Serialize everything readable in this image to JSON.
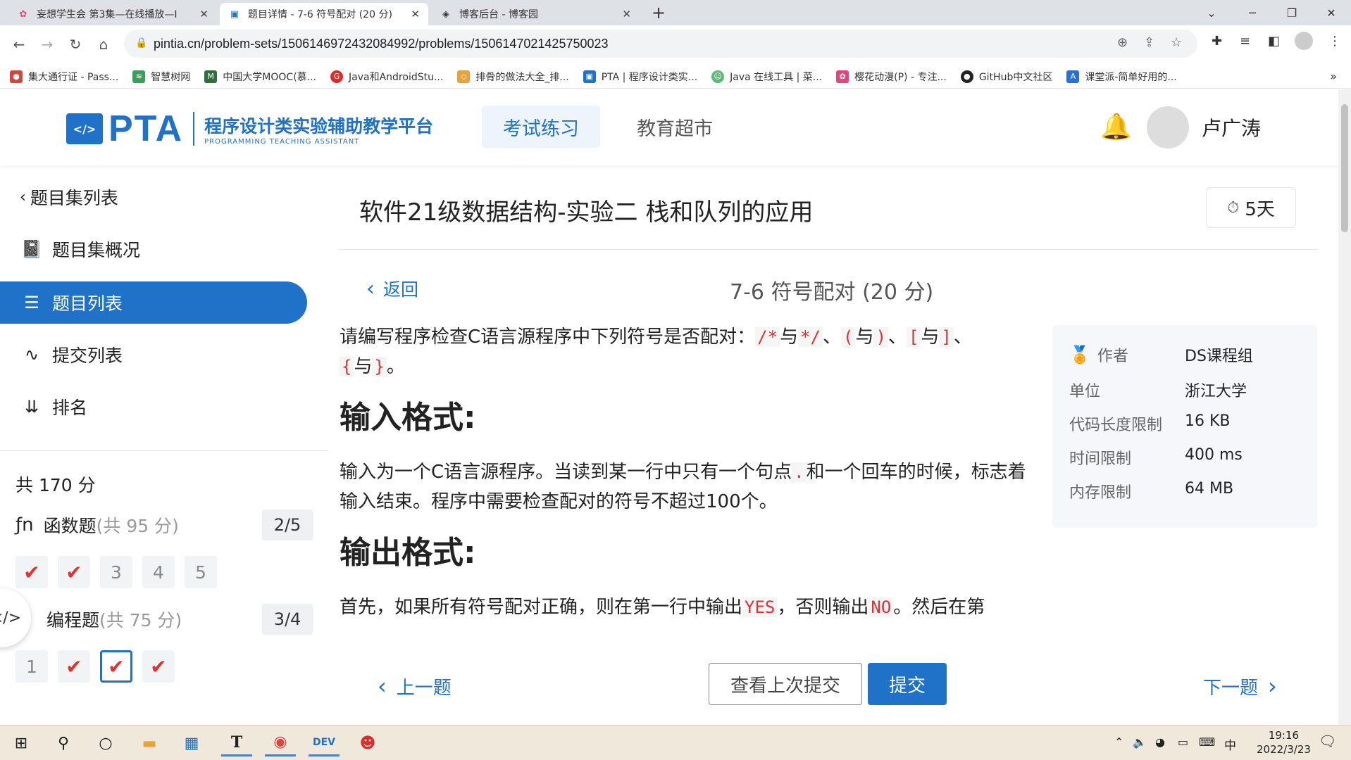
{
  "browser": {
    "tabs": [
      {
        "title": "妄想学生会 第3集—在线播放—I",
        "icon": "flower-icon",
        "active": false
      },
      {
        "title": "题目详情 - 7-6 符号配对 (20 分)",
        "icon": "pta-icon",
        "active": true
      },
      {
        "title": "博客后台 - 博客园",
        "icon": "cnblogs-icon",
        "active": false
      }
    ],
    "new_tab": "+",
    "url": "pintia.cn/problem-sets/1506146972432084992/problems/1506147021425750023",
    "bookmarks": [
      "集大通行证 - Pass...",
      "智慧树网",
      "中国大学MOOC(慕...",
      "Java和AndroidStu...",
      "排骨的做法大全_排...",
      "PTA | 程序设计类实...",
      "Java 在线工具 | 菜...",
      "樱花动漫(P) - 专注...",
      "GitHub中文社区",
      "课堂派-简单好用的..."
    ],
    "bookmarks_more": "»"
  },
  "header": {
    "logo_abbr": "PTA",
    "logo_cn": "程序设计类实验辅助教学平台",
    "logo_en": "PROGRAMMING TEACHING ASSISTANT",
    "nav": [
      "考试练习",
      "教育超市"
    ],
    "username": "卢广涛"
  },
  "sidebar": {
    "back_link": "题目集列表",
    "items": [
      {
        "label": "题目集概况",
        "icon": "book-icon"
      },
      {
        "label": "题目列表",
        "icon": "list-icon",
        "active": true
      },
      {
        "label": "提交列表",
        "icon": "activity-icon"
      },
      {
        "label": "排名",
        "icon": "rank-icon"
      }
    ],
    "total": "共 170 分",
    "groups": [
      {
        "label": "函数题",
        "sub": "(共 95 分)",
        "count": "2/5",
        "questions": [
          "✔",
          "✔",
          "3",
          "4",
          "5"
        ]
      },
      {
        "label": "编程题",
        "sub": "(共 75 分)",
        "count": "3/4",
        "questions": [
          "1",
          "✔",
          "✔",
          "✔"
        ]
      }
    ]
  },
  "main": {
    "set_title": "软件21级数据结构-实验二 栈和队列的应用",
    "timer": "5天",
    "back": "返回",
    "problem_title": "7-6 符号配对 (20 分)",
    "desc_prefix": "请编写程序检查C语言源程序中下列符号是否配对：",
    "symbols": [
      "/*",
      "与",
      "*/",
      "、",
      "(",
      "与",
      ")",
      "、",
      "[",
      "与",
      "]",
      "、",
      "{",
      "与",
      "}",
      "。"
    ],
    "input_heading": "输入格式:",
    "input_text_1": "输入为一个C语言源程序。当读到某一行中只有一个句点",
    "input_code": ".",
    "input_text_2": "和一个回车的时候，标志着输入结束。程序中需要检查配对的符号不超过100个。",
    "output_heading": "输出格式:",
    "output_text_1": "首先，如果所有符号配对正确，则在第一行中输出",
    "output_code_1": "YES",
    "output_text_2": "，否则输出",
    "output_code_2": "NO",
    "output_text_3": "。然后在第"
  },
  "info": [
    {
      "label": "作者",
      "value": "DS课程组"
    },
    {
      "label": "单位",
      "value": "浙江大学"
    },
    {
      "label": "代码长度限制",
      "value": "16 KB"
    },
    {
      "label": "时间限制",
      "value": "400 ms"
    },
    {
      "label": "内存限制",
      "value": "64 MB"
    }
  ],
  "footer": {
    "prev": "上一题",
    "last_submission": "查看上次提交",
    "submit": "提交",
    "next": "下一题"
  },
  "taskbar": {
    "time": "19:16",
    "date": "2022/3/23",
    "ime": "中"
  },
  "colors": {
    "accent": "#1f72c8",
    "error": "#e03131"
  }
}
